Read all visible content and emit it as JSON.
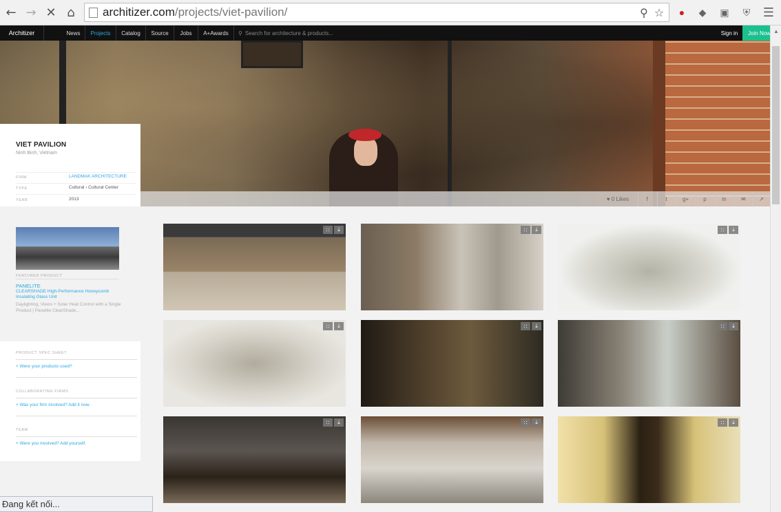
{
  "browser": {
    "url_domain": "architizer.com",
    "url_path": "/projects/viet-pavilion/",
    "status_text": "Đang kết nối..."
  },
  "site": {
    "logo": "Architizer",
    "nav": [
      "News",
      "Projects",
      "Catalog",
      "Source",
      "Jobs",
      "A+Awards"
    ],
    "active_nav": "Projects",
    "search_placeholder": "Search for architecture & products...",
    "signin": "Sign in",
    "join": "Join Now",
    "accent": "#2aa7e1",
    "join_color": "#1cc08f"
  },
  "project": {
    "title": "VIET PAVILION",
    "location": "Ninh Binh, Vietnam",
    "meta": [
      {
        "label": "FIRM",
        "value": "LANDMAK ARCHITECTURE",
        "link": true
      },
      {
        "label": "TYPE",
        "value": "Cultural › Cultural Center",
        "link": false
      },
      {
        "label": "YEAR",
        "value": "2013",
        "link": false
      }
    ],
    "likes": "0 Likes"
  },
  "share_icons": [
    "heart-icon",
    "facebook-icon",
    "twitter-icon",
    "google-plus-icon",
    "pinterest-icon",
    "linkedin-icon",
    "email-icon",
    "share-icon"
  ],
  "featured_product": {
    "label": "FEATURED PRODUCT",
    "brand": "PANELITE",
    "name": "CLEARSHADE High-Performance Honeycomb Insulating Glass Unit",
    "description": "Daylighting, Views + Solar Heat Control with a Single Product | Panelite ClearShade..."
  },
  "side_sections": [
    {
      "label": "PRODUCT SPEC SHEET",
      "link": "+   Were your products used?"
    },
    {
      "label": "COLLABORATING FIRMS",
      "link": "+   Was your firm involved? Add it now."
    },
    {
      "label": "TEAM",
      "link": "+   Were you involved? Add yourself."
    }
  ],
  "gallery": [
    {
      "name": "interior-stone-wall-photo",
      "style": "t-stone"
    },
    {
      "name": "interior-column-chair-photo",
      "style": "t-stone2"
    },
    {
      "name": "exterior-3d-model-render",
      "style": "t-model"
    },
    {
      "name": "floor-plan-3d-model-render",
      "style": "t-model2"
    },
    {
      "name": "interior-night-portrait-photo",
      "style": "t-night"
    },
    {
      "name": "stone-window-courtyard-photo",
      "style": "t-day"
    },
    {
      "name": "night-exterior-photo",
      "style": "t-dusk"
    },
    {
      "name": "stone-courtyard-photo",
      "style": "t-courtyard"
    },
    {
      "name": "vase-courtyard-photo",
      "style": "t-vase"
    }
  ]
}
